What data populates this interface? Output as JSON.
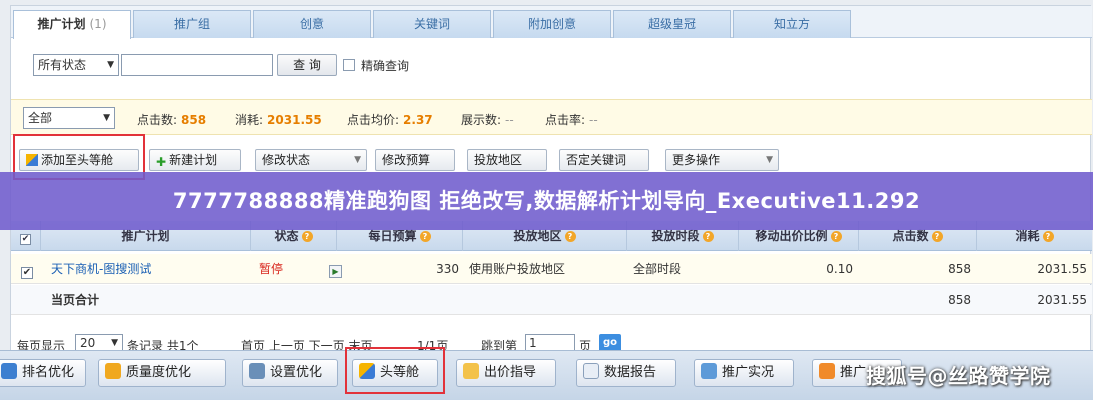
{
  "tabs": [
    {
      "label": "推广计划",
      "count": "(1)",
      "active": true
    },
    {
      "label": "推广组"
    },
    {
      "label": "创意"
    },
    {
      "label": "关键词"
    },
    {
      "label": "附加创意"
    },
    {
      "label": "超级皇冠"
    },
    {
      "label": "知立方"
    }
  ],
  "search": {
    "status_select": "所有状态",
    "query_button": "查 询",
    "exact_label": "精确查询"
  },
  "stats": {
    "range_select": "全部",
    "clicks_label": "点击数:",
    "clicks_value": "858",
    "cost_label": "消耗:",
    "cost_value": "2031.55",
    "avg_price_label": "点击均价:",
    "avg_price_value": "2.37",
    "impressions_label": "展示数:",
    "impressions_value": "--",
    "ctr_label": "点击率:",
    "ctr_value": "--"
  },
  "toolbar": {
    "add_top": "添加至头等舱",
    "new_plan": "新建计划",
    "modify_status": "修改状态",
    "modify_budget": "修改预算",
    "region": "投放地区",
    "neg_keywords": "否定关键词",
    "more_ops": "更多操作"
  },
  "banner": "7777788888精准跑狗图 拒绝改写,数据解析计划导向_Executive11.292",
  "table": {
    "headers": [
      "推广计划",
      "状态",
      "每日预算",
      "投放地区",
      "投放时段",
      "移动出价比例",
      "点击数",
      "消耗"
    ],
    "row": {
      "name": "天下商机-图搜测试",
      "status": "暂停",
      "budget": "330",
      "region": "使用账户投放地区",
      "schedule": "全部时段",
      "mobile_ratio": "0.10",
      "clicks": "858",
      "cost": "2031.55"
    },
    "total": {
      "label": "当页合计",
      "clicks": "858",
      "cost": "2031.55"
    }
  },
  "pager": {
    "per_page_label": "每页显示",
    "per_page_value": "20",
    "records": "条记录  共1个",
    "nav": "首页 上一页 下一页 末页",
    "page_info": "1/1页",
    "jump_label": "跳到第",
    "jump_value": "1",
    "page_suffix": "页",
    "go": "go"
  },
  "bottom": {
    "rank": "排名优化",
    "quality": "质量度优化",
    "settings": "设置优化",
    "first_class": "头等舱",
    "bid_guide": "出价指导",
    "report": "数据报告",
    "practice": "推广实况",
    "partial": "推广"
  },
  "watermark": "搜狐号@丝路赞学院",
  "colors": {
    "highlight_red": "#e2323a",
    "banner_purple": "#705ccd",
    "stat_orange": "#e67e00",
    "status_red": "#d8261c"
  }
}
